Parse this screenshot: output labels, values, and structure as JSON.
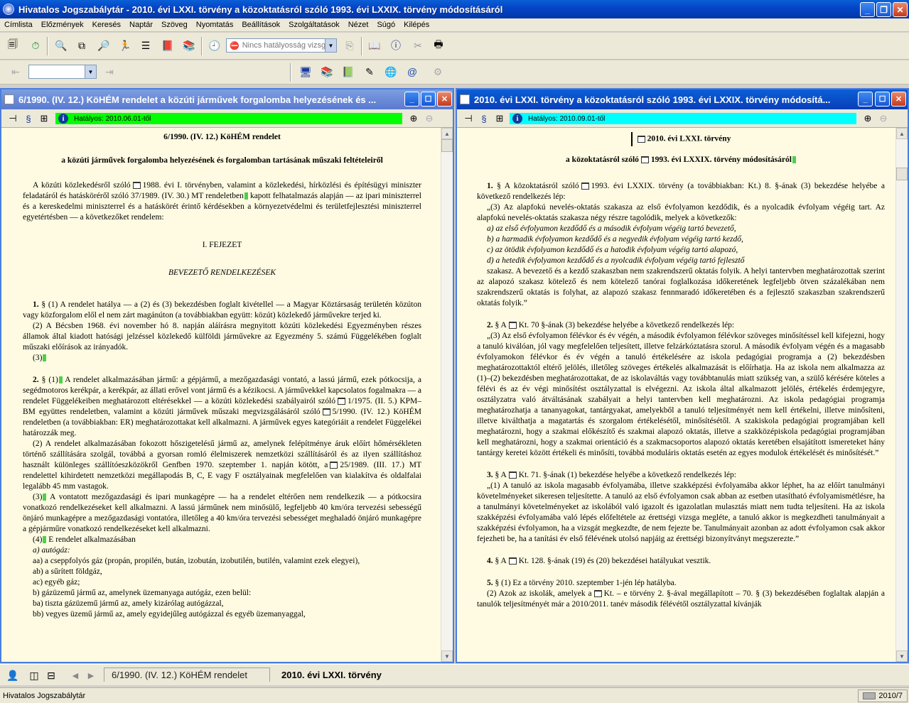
{
  "window": {
    "title": "Hivatalos Jogszabálytár - 2010. évi LXXI. törvény a közoktatásról szóló 1993. évi LXXIX. törvény módosításáról"
  },
  "menu": [
    "Címlista",
    "Előzmények",
    "Keresés",
    "Naptár",
    "Szöveg",
    "Nyomtatás",
    "Beállítások",
    "Szolgáltatások",
    "Nézet",
    "Súgó",
    "Kilépés"
  ],
  "toolbar": {
    "validity_combo": "Nincs hatályosság vizsg",
    "small_combo": ""
  },
  "left_pane": {
    "title": "6/1990. (IV. 12.) KöHÉM rendelet a közúti járművek forgalomba helyezésének és ...",
    "status": "Hatályos: 2010.06.01-től",
    "status_color": "#00ff00",
    "doc": {
      "title": "6/1990. (IV. 12.) KöHÉM rendelet",
      "subtitle": "a közúti járművek forgalomba helyezésének és forgalomban tartásának műszaki feltételeiről",
      "preamble_a": "A közúti közlekedésről szóló",
      "preamble_b": "1988. évi I. törvényben, valamint a közlekedési, hírközlési és építésügyi miniszter feladatáról és hatásköréről szóló 37/1989. (IV. 30.) MT rendeletben",
      "preamble_c": "kapott felhatalmazás alapján — az ipari miniszterrel és a kereskedelmi miniszterrel és a hatáskörét érintő kérdésekben a környezetvédelmi és területfejlesztési miniszterrel egyetértésben — a következőket rendelem:",
      "chapter": "I. FEJEZET",
      "chapter_title": "BEVEZETŐ RENDELKEZÉSEK",
      "s1_num": "1.",
      "s1_p1": "§ (1) A rendelet hatálya — a (2) és (3) bekezdésben foglalt kivétellel — a Magyar Köztársaság területén közúton vagy közforgalom elől el nem zárt magánúton (a továbbiakban együtt: közút) közlekedő járművekre terjed ki.",
      "s1_p2": "(2) A Bécsben 1968. évi november hó 8. napján aláírásra megnyitott közúti közlekedési Egyezményben részes államok által kiadott hatósági jelzéssel közlekedő külföldi járművekre az Egyezmény 5. számú Függelékében foglalt műszaki előírások az irányadók.",
      "s1_p3": "(3)",
      "s2_num": "2.",
      "s2_p1a": "§ (1)",
      "s2_p1b": "A rendelet alkalmazásában jármű: a gépjármű, a mezőgazdasági vontató, a lassú jármű, ezek pótkocsija, a segédmotoros kerékpár, a kerékpár, az állati erővel vont jármű és a kézikocsi. A járművekkel kapcsolatos fogalmakra — a rendelet Függelékeiben meghatározott eltérésekkel — a közúti közlekedési szabályairól szóló",
      "s2_p1c": "1/1975. (II. 5.) KPM–BM együttes rendeletben, valamint a közúti járművek műszaki megvizsgálásáról szóló",
      "s2_p1d": "5/1990. (IV. 12.) KöHÉM rendeletben (a továbbiakban: ER) meghatározottakat kell alkalmazni. A járművek egyes kategóriáit a rendelet Függelékei határozzák meg.",
      "s2_p2a": "(2) A rendelet alkalmazásában fokozott hőszigetelésű jármű az, amelynek felépítménye áruk előírt hőmérsékleten történő szállítására szolgál, továbbá a gyorsan romló élelmiszerek nemzetközi szállításáról és az ilyen szállításhoz használt különleges szállítóeszközökről Genfben 1970. szeptember 1. napján kötött, a",
      "s2_p2b": "25/1989. (III. 17.) MT rendelettel kihirdetett nemzetközi megállapodás B, C, E vagy F osztályainak megfelelően van kialakítva és oldalfalai legalább 45 mm vastagok.",
      "s2_p3a": "(3)",
      "s2_p3b": "A vontatott mezőgazdasági és ipari munkagépre — ha a rendelet eltérően nem rendelkezik — a pótkocsira vonatkozó rendelkezéseket kell alkalmazni. A lassú járműnek nem minősülő, legfeljebb 40 km/óra tervezési sebességű önjáró munkagépre a mezőgazdasági vontatóra, illetőleg a 40 km/óra tervezési sebességet meghaladó önjáró munkagépre a gépjárműre vonatkozó rendelkezéseket kell alkalmazni.",
      "s2_p4a": "(4)",
      "s2_p4b": "E rendelet alkalmazásában",
      "s2_a": "a) autógáz:",
      "s2_aa": "aa) a cseppfolyós gáz (propán, propilén, bután, izobután, izobutilén, butilén, valamint ezek elegyei),",
      "s2_ab": "ab) a sűrített földgáz,",
      "s2_ac": "ac) egyéb gáz;",
      "s2_b": "b) gázüzemű jármű az, amelynek üzemanyaga autógáz, ezen belül:",
      "s2_ba": "ba) tiszta gázüzemű jármű az, amely kizárólag autógázzal,",
      "s2_bb": "bb) vegyes üzemű jármű az, amely egyidejűleg autógázzal és egyéb üzemanyaggal,"
    }
  },
  "right_pane": {
    "title": "2010. évi LXXI. törvény a közoktatásról szóló 1993. évi LXXIX. törvény módosítá...",
    "status": "Hatályos: 2010.09.01-től",
    "status_color": "#00ffff",
    "doc": {
      "title": "2010. évi LXXI. törvény",
      "subtitle_a": "a közoktatásról szóló",
      "subtitle_b": "1993. évi LXXIX. törvény módosításáról",
      "s1_num": "1.",
      "s1_a": "§ A közoktatásról szóló",
      "s1_b": "1993. évi LXXIX. törvény (a továbbiakban: Kt.) 8. §-ának (3) bekezdése helyébe a következő rendelkezés lép:",
      "s1_q": "„(3) Az alapfokú nevelés-oktatás szakasza az első évfolyamon kezdődik, és a nyolcadik évfolyam végéig tart. Az alapfokú nevelés-oktatás szakasza négy részre tagolódik, melyek a következők:",
      "s1_la": "a) az első évfolyamon kezdődő és a második évfolyam végéig tartó bevezető,",
      "s1_lb": "b) a harmadik évfolyamon kezdődő és a negyedik évfolyam végéig tartó kezdő,",
      "s1_lc": "c) az ötödik évfolyamon kezdődő és a hatodik évfolyam végéig tartó alapozó,",
      "s1_ld": "d) a hetedik évfolyamon kezdődő és a nyolcadik évfolyam végéig tartó fejlesztő",
      "s1_end": "szakasz. A bevezető és a kezdő szakaszban nem szakrendszerű oktatás folyik. A helyi tantervben meghatározottak szerint az alapozó szakasz kötelező és nem kötelező tanórai foglalkozása időkeretének legfeljebb ötven százalékában nem szakrendszerű oktatás is folyhat, az alapozó szakasz fennmaradó időkeretében és a fejlesztő szakaszban szakrendszerű oktatás folyik.”",
      "s2_num": "2.",
      "s2_a": "§ A",
      "s2_b": "Kt. 70 §-ának (3) bekezdése helyébe a következő rendelkezés lép:",
      "s2_q": "„(3) Az első évfolyamon félévkor és év végén, a második évfolyamon félévkor szöveges minősítéssel kell kifejezni, hogy a tanuló kiválóan, jól vagy megfelelően teljesített, illetve felzárkóztatásra szorul. A második évfolyam végén és a magasabb évfolyamokon félévkor és év végén a tanuló értékelésére az iskola pedagógiai programja a (2) bekezdésben meghatározottaktól eltérő jelölés, illetőleg szöveges értékelés alkalmazását is előírhatja. Ha az iskola nem alkalmazza az (1)–(2) bekezdésben meghatározottakat, de az iskolaváltás vagy továbbtanulás miatt szükség van, a szülő kérésére köteles a félévi és az év végi minősítést osztályzattal is elvégezni. Az iskola által alkalmazott jelölés, értékelés érdemjegyre, osztályzatra való átváltásának szabályait a helyi tantervben kell meghatározni. Az iskola pedagógiai programja meghatározhatja a tananyagokat, tantárgyakat, amelyekből a tanuló teljesítményét nem kell értékelni, illetve minősíteni, illetve kiválthatja a magatartás és szorgalom értékelésétől, minősítésétől. A szakiskola pedagógiai programjában kell meghatározni, hogy a szakmai előkészítő és szakmai alapozó oktatás, illetve a szakközépiskola pedagógiai programjában kell meghatározni, hogy a szakmai orientáció és a szakmacsoportos alapozó oktatás keretében elsajátított ismereteket hány tantárgy keretei között értékeli és minősíti, továbbá moduláris oktatás esetén az egyes modulok értékelését és minősítését.”",
      "s3_num": "3.",
      "s3_a": "§ A",
      "s3_b": "Kt. 71. §-ának (1) bekezdése helyébe a következő rendelkezés lép:",
      "s3_q": "„(1) A tanuló az iskola magasabb évfolyamába, illetve szakképzési évfolyamába akkor léphet, ha az előírt tanulmányi követelményeket sikeresen teljesítette. A tanuló az első évfolyamon csak abban az esetben utasítható évfolyamismétlésre, ha a tanulmányi követelményeket az iskolából való igazolt és igazolatlan mulasztás miatt nem tudta teljesíteni. Ha az iskola szakképzési évfolyamába való lépés előfeltétele az érettségi vizsga megléte, a tanuló akkor is megkezdheti tanulmányait a szakképzési évfolyamon, ha a vizsgát megkezdte, de nem fejezte be. Tanulmányait azonban az adott évfolyamon csak akkor fejezheti be, ha a tanítási év első félévének utolsó napjáig az érettségi bizonyítványt megszerezte.”",
      "s4_num": "4.",
      "s4_a": "§ A",
      "s4_b": "Kt. 128. §-ának (19) és (20) bekezdései hatályukat vesztik.",
      "s5_num": "5.",
      "s5_a": "§ (1) Ez a törvény 2010. szeptember 1-jén lép hatályba.",
      "s5_b": "(2) Azok az iskolák, amelyek a",
      "s5_c": "Kt. – e törvény 2. §-ával megállapított – 70. § (3) bekezdésében foglaltak alapján a tanulók teljesítményét már a 2010/2011. tanév második félévétől osztályzattal kívánják"
    }
  },
  "tabs": [
    "6/1990. (IV. 12.) KöHÉM rendelet",
    "2010. évi LXXI. törvény"
  ],
  "statusbar": {
    "left": "Hivatalos Jogszabálytár",
    "right": "2010/7"
  }
}
